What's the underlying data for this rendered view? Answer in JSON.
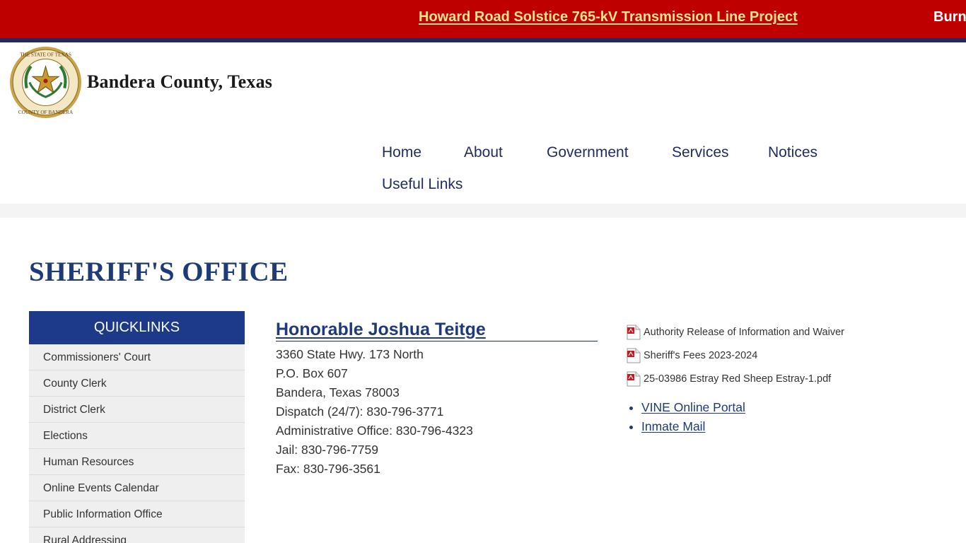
{
  "ticker": {
    "primary_label": "Howard Road Solstice 765-kV Transmission Line Project",
    "secondary_label": "Burn",
    "colors": {
      "background": "#bf0000",
      "primary_text": "#ffe48a",
      "rule": "#1d2c5c"
    }
  },
  "header": {
    "seal_icon": "county-seal-icon",
    "site_title": "Bandera County, Texas"
  },
  "nav": {
    "items": [
      {
        "label": "Home"
      },
      {
        "label": "About"
      },
      {
        "label": "Government"
      },
      {
        "label": "Services"
      },
      {
        "label": "Notices"
      },
      {
        "label": "Useful Links"
      }
    ]
  },
  "page": {
    "title": "SHERIFF'S OFFICE"
  },
  "quicklinks": {
    "heading": "QUICKLINKS",
    "items": [
      {
        "label": "Commissioners' Court"
      },
      {
        "label": "County Clerk"
      },
      {
        "label": "District Clerk"
      },
      {
        "label": "Elections"
      },
      {
        "label": "Human Resources"
      },
      {
        "label": "Online Events Calendar"
      },
      {
        "label": "Public Information Office"
      },
      {
        "label": "Rural Addressing"
      }
    ]
  },
  "contact": {
    "official_name": "Honorable Joshua Teitge",
    "lines": [
      "3360 State Hwy. 173 North",
      "P.O. Box 607",
      "Bandera, Texas 78003",
      "Dispatch (24/7): 830-796-3771",
      "Administrative Office: 830-796-4323",
      "Jail: 830-796-7759",
      "Fax: 830-796-3561"
    ]
  },
  "documents": {
    "icon": "pdf-icon",
    "items": [
      {
        "label": "Authority Release of Information and Waiver"
      },
      {
        "label": "Sheriff's Fees 2023-2024"
      },
      {
        "label": "25-03986 Estray Red Sheep Estray-1.pdf"
      }
    ]
  },
  "external_links": [
    {
      "label": "VINE Online Portal"
    },
    {
      "label": "Inmate Mail"
    }
  ],
  "colors": {
    "accent_blue": "#1d3a8a",
    "title_blue": "#1e3a78",
    "sidebar_bg": "#efefef",
    "pdf_red": "#d0141b"
  }
}
